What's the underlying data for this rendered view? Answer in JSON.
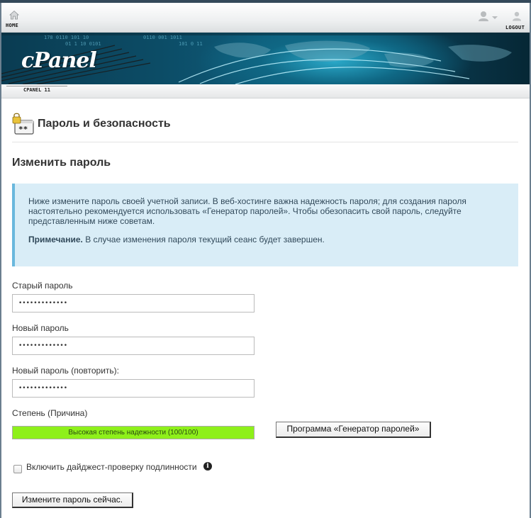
{
  "topnav": {
    "home_label": "HOME",
    "logout_label": "LOGOUT",
    "home_icon": "home-icon",
    "user_icon": "user-icon",
    "logout_icon": "logout-icon"
  },
  "banner": {
    "logo_text": "cPanel"
  },
  "subbar": {
    "tab_label": "CPANEL 11"
  },
  "page": {
    "title": "Пароль и безопасность",
    "icon": "lock-password-icon",
    "section_title": "Изменить пароль"
  },
  "info": {
    "text": "Ниже измените пароль своей учетной записи. В веб-хостинге важна надежность пароля; для создания пароля настоятельно рекомендуется использовать «Генератор паролей». Чтобы обезопасить свой пароль, следуйте представленным ниже советам.",
    "note_label": "Примечание.",
    "note_text": " В случае изменения пароля текущий сеанс будет завершен."
  },
  "form": {
    "old_password_label": "Старый пароль",
    "old_password_value": "•••••••••••••",
    "new_password_label": "Новый пароль",
    "new_password_value": "•••••••••••••",
    "repeat_password_label": "Новый пароль (повторить):",
    "repeat_password_value": "•••••••••••••",
    "strength_label": "Степень (Причина)",
    "strength_text": "Высокая степень надежности (100/100)",
    "strength_value": 100,
    "generator_button": "Программа «Генератор паролей»",
    "digest_label": "Включить дайджест-проверку подлинности",
    "digest_checked": false,
    "submit_button": "Измените пароль сейчас."
  },
  "colors": {
    "strength_fill": "#8ef01a",
    "info_bg": "#d9edf7",
    "info_border": "#6ab8dd"
  }
}
